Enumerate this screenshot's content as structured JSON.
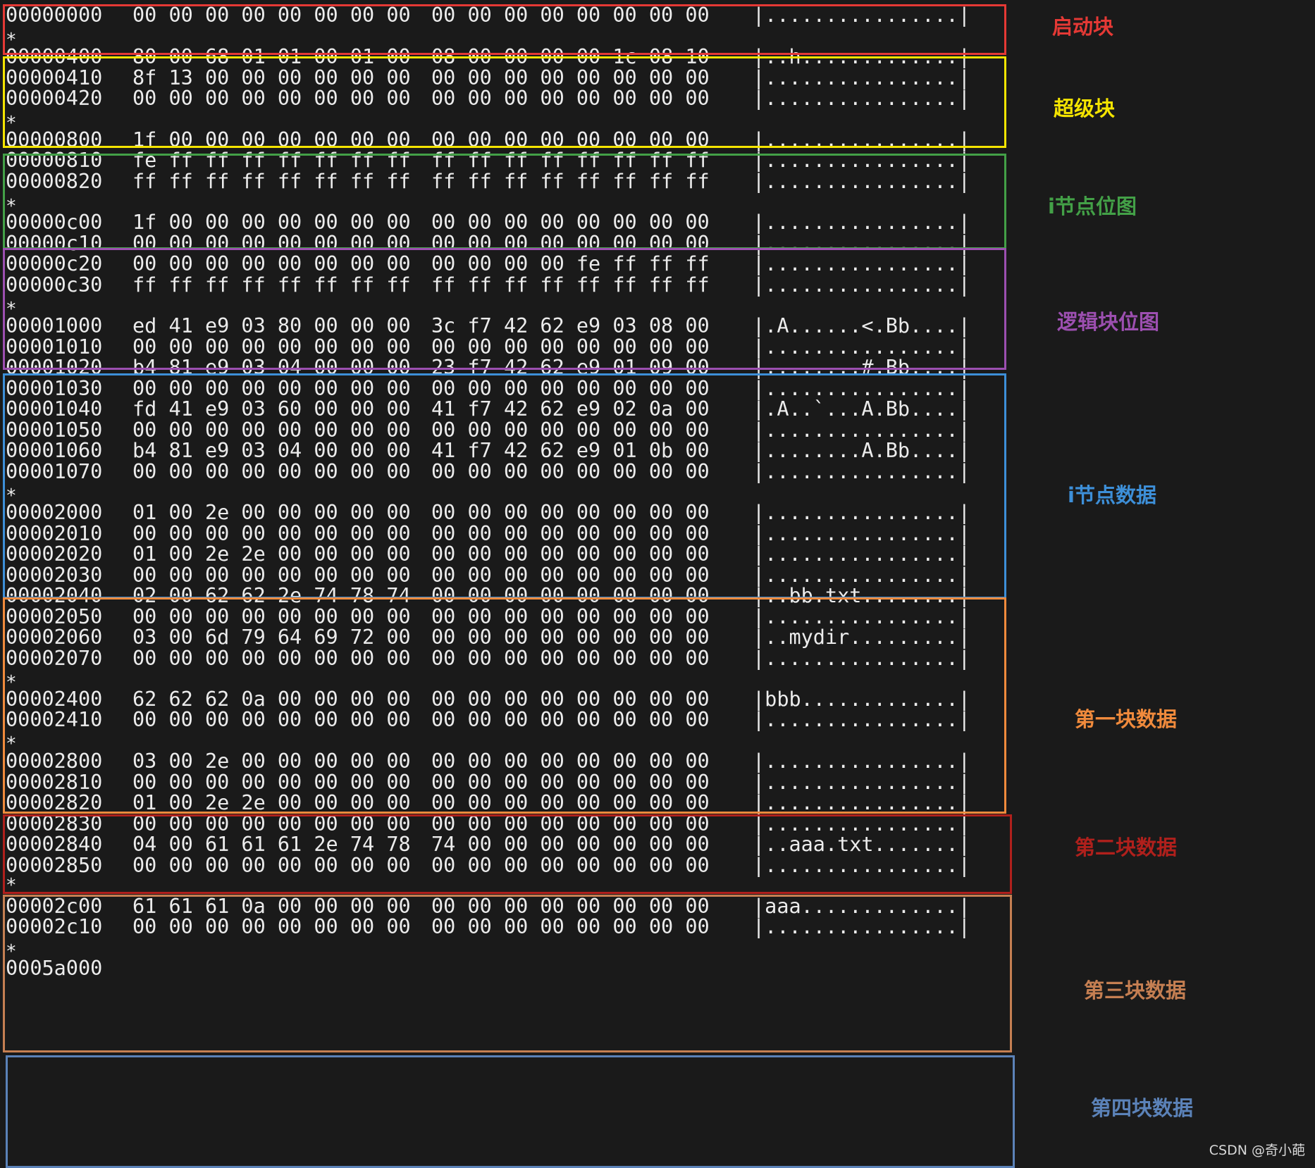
{
  "rows": [
    {
      "off": "00000000",
      "h1": "00 00 00 00 00 00 00 00",
      "h2": "00 00 00 00 00 00 00 00",
      "asc": "|................|"
    },
    {
      "off": "00000400",
      "h1": "80 00 68 01 01 00 01 00",
      "h2": "08 00 00 00 00 1c 08 10",
      "asc": "|..h.............|"
    },
    {
      "off": "00000410",
      "h1": "8f 13 00 00 00 00 00 00",
      "h2": "00 00 00 00 00 00 00 00",
      "asc": "|................|"
    },
    {
      "off": "00000420",
      "h1": "00 00 00 00 00 00 00 00",
      "h2": "00 00 00 00 00 00 00 00",
      "asc": "|................|"
    },
    {
      "off": "00000800",
      "h1": "1f 00 00 00 00 00 00 00",
      "h2": "00 00 00 00 00 00 00 00",
      "asc": "|................|"
    },
    {
      "off": "00000810",
      "h1": "fe ff ff ff ff ff ff ff",
      "h2": "ff ff ff ff ff ff ff ff",
      "asc": "|................|"
    },
    {
      "off": "00000820",
      "h1": "ff ff ff ff ff ff ff ff",
      "h2": "ff ff ff ff ff ff ff ff",
      "asc": "|................|"
    },
    {
      "off": "00000c00",
      "h1": "1f 00 00 00 00 00 00 00",
      "h2": "00 00 00 00 00 00 00 00",
      "asc": "|................|"
    },
    {
      "off": "00000c10",
      "h1": "00 00 00 00 00 00 00 00",
      "h2": "00 00 00 00 00 00 00 00",
      "asc": "|................|"
    },
    {
      "off": "00000c20",
      "h1": "00 00 00 00 00 00 00 00",
      "h2": "00 00 00 00 fe ff ff ff",
      "asc": "|................|"
    },
    {
      "off": "00000c30",
      "h1": "ff ff ff ff ff ff ff ff",
      "h2": "ff ff ff ff ff ff ff ff",
      "asc": "|................|"
    },
    {
      "off": "00001000",
      "h1": "ed 41 e9 03 80 00 00 00",
      "h2": "3c f7 42 62 e9 03 08 00",
      "asc": "|.A......<.Bb....|"
    },
    {
      "off": "00001010",
      "h1": "00 00 00 00 00 00 00 00",
      "h2": "00 00 00 00 00 00 00 00",
      "asc": "|................|"
    },
    {
      "off": "00001020",
      "h1": "b4 81 e9 03 04 00 00 00",
      "h2": "23 f7 42 62 e9 01 09 00",
      "asc": "|........#.Bb....|"
    },
    {
      "off": "00001030",
      "h1": "00 00 00 00 00 00 00 00",
      "h2": "00 00 00 00 00 00 00 00",
      "asc": "|................|"
    },
    {
      "off": "00001040",
      "h1": "fd 41 e9 03 60 00 00 00",
      "h2": "41 f7 42 62 e9 02 0a 00",
      "asc": "|.A..`...A.Bb....|"
    },
    {
      "off": "00001050",
      "h1": "00 00 00 00 00 00 00 00",
      "h2": "00 00 00 00 00 00 00 00",
      "asc": "|................|"
    },
    {
      "off": "00001060",
      "h1": "b4 81 e9 03 04 00 00 00",
      "h2": "41 f7 42 62 e9 01 0b 00",
      "asc": "|........A.Bb....|"
    },
    {
      "off": "00001070",
      "h1": "00 00 00 00 00 00 00 00",
      "h2": "00 00 00 00 00 00 00 00",
      "asc": "|................|"
    },
    {
      "off": "00002000",
      "h1": "01 00 2e 00 00 00 00 00",
      "h2": "00 00 00 00 00 00 00 00",
      "asc": "|................|"
    },
    {
      "off": "00002010",
      "h1": "00 00 00 00 00 00 00 00",
      "h2": "00 00 00 00 00 00 00 00",
      "asc": "|................|"
    },
    {
      "off": "00002020",
      "h1": "01 00 2e 2e 00 00 00 00",
      "h2": "00 00 00 00 00 00 00 00",
      "asc": "|................|"
    },
    {
      "off": "00002030",
      "h1": "00 00 00 00 00 00 00 00",
      "h2": "00 00 00 00 00 00 00 00",
      "asc": "|................|"
    },
    {
      "off": "00002040",
      "h1": "02 00 62 62 2e 74 78 74",
      "h2": "00 00 00 00 00 00 00 00",
      "asc": "|..bb.txt........|"
    },
    {
      "off": "00002050",
      "h1": "00 00 00 00 00 00 00 00",
      "h2": "00 00 00 00 00 00 00 00",
      "asc": "|................|"
    },
    {
      "off": "00002060",
      "h1": "03 00 6d 79 64 69 72 00",
      "h2": "00 00 00 00 00 00 00 00",
      "asc": "|..mydir.........|"
    },
    {
      "off": "00002070",
      "h1": "00 00 00 00 00 00 00 00",
      "h2": "00 00 00 00 00 00 00 00",
      "asc": "|................|"
    },
    {
      "off": "00002400",
      "h1": "62 62 62 0a 00 00 00 00",
      "h2": "00 00 00 00 00 00 00 00",
      "asc": "|bbb.............|"
    },
    {
      "off": "00002410",
      "h1": "00 00 00 00 00 00 00 00",
      "h2": "00 00 00 00 00 00 00 00",
      "asc": "|................|"
    },
    {
      "off": "00002800",
      "h1": "03 00 2e 00 00 00 00 00",
      "h2": "00 00 00 00 00 00 00 00",
      "asc": "|................|"
    },
    {
      "off": "00002810",
      "h1": "00 00 00 00 00 00 00 00",
      "h2": "00 00 00 00 00 00 00 00",
      "asc": "|................|"
    },
    {
      "off": "00002820",
      "h1": "01 00 2e 2e 00 00 00 00",
      "h2": "00 00 00 00 00 00 00 00",
      "asc": "|................|"
    },
    {
      "off": "00002830",
      "h1": "00 00 00 00 00 00 00 00",
      "h2": "00 00 00 00 00 00 00 00",
      "asc": "|................|"
    },
    {
      "off": "00002840",
      "h1": "04 00 61 61 61 2e 74 78",
      "h2": "74 00 00 00 00 00 00 00",
      "asc": "|..aaa.txt.......|"
    },
    {
      "off": "00002850",
      "h1": "00 00 00 00 00 00 00 00",
      "h2": "00 00 00 00 00 00 00 00",
      "asc": "|................|"
    },
    {
      "off": "00002c00",
      "h1": "61 61 61 0a 00 00 00 00",
      "h2": "00 00 00 00 00 00 00 00",
      "asc": "|aaa.............|"
    },
    {
      "off": "00002c10",
      "h1": "00 00 00 00 00 00 00 00",
      "h2": "00 00 00 00 00 00 00 00",
      "asc": "|................|"
    },
    {
      "off": "0005a000",
      "h1": "",
      "h2": "",
      "asc": ""
    }
  ],
  "star": "*",
  "regions": [
    {
      "label": "启动块",
      "color": "#e53935"
    },
    {
      "label": "超级块",
      "color": "#f4e400"
    },
    {
      "label": "i节点位图",
      "color": "#43a047"
    },
    {
      "label": "逻辑块位图",
      "color": "#9c4fb0"
    },
    {
      "label": "i节点数据",
      "color": "#3d8fd8"
    },
    {
      "label": "第一块数据",
      "color": "#f08a3c"
    },
    {
      "label": "第二块数据",
      "color": "#b0201c"
    },
    {
      "label": "第三块数据",
      "color": "#c57f52"
    },
    {
      "label": "第四块数据",
      "color": "#5b82b8"
    }
  ],
  "watermark": "CSDN @奇小葩"
}
